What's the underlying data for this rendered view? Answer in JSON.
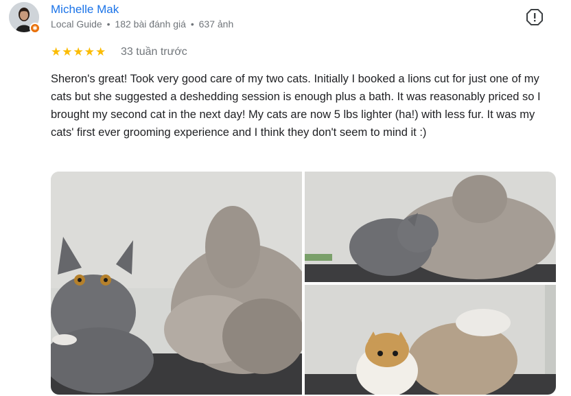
{
  "reviewer": {
    "name": "Michelle Mak",
    "badge": "Local Guide",
    "reviews": "182 bài đánh giá",
    "photos": "637 ảnh",
    "separator": "•"
  },
  "review": {
    "rating": 5,
    "stars_text": "★★★★★",
    "time_ago": "33 tuần trước",
    "text": "Sheron's great! Took very good care of my two cats. Initially I booked a lions cut for just one of my cats but she suggested a deshedding session is enough plus a bath. It was reasonably priced so I brought my second cat in the next day! My cats are now 5 lbs lighter (ha!) with less fur. It was my cats' first ever grooming experience and I think they don't seem to mind it :)"
  },
  "icons": {
    "report": "report-icon",
    "local_guide": "local-guide-star-icon"
  },
  "colors": {
    "name_link": "#1a73e8",
    "stars": "#fbbc04",
    "secondary_text": "#70757a",
    "badge": "#e8710a"
  }
}
